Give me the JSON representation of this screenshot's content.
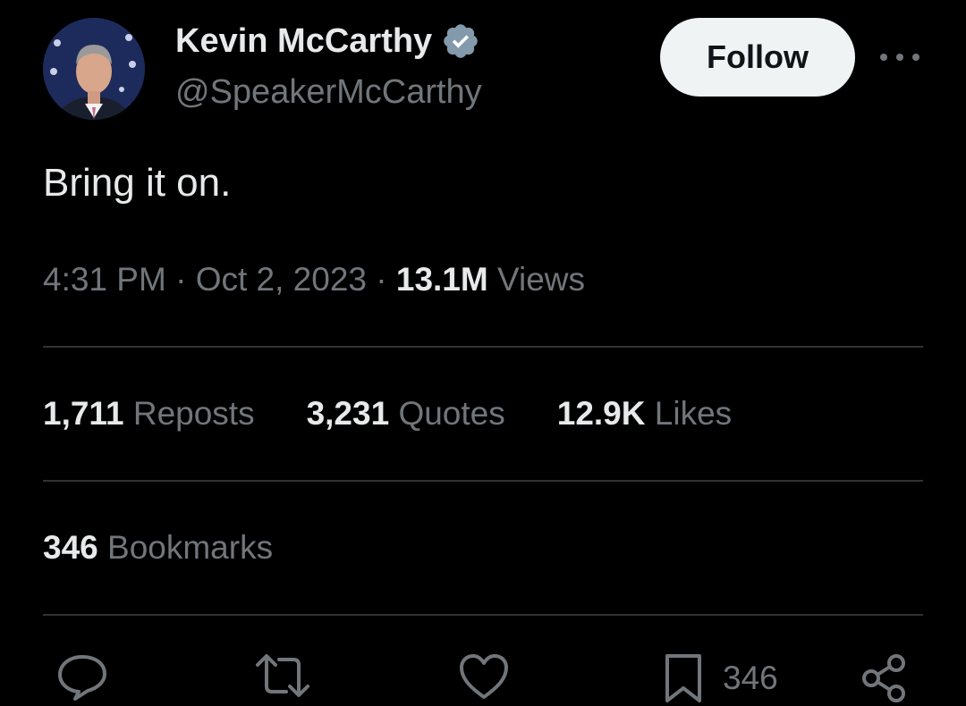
{
  "author": {
    "display_name": "Kevin McCarthy",
    "handle": "@SpeakerMcCarthy",
    "verified_icon": "verified-badge-icon",
    "avatar": "profile-photo"
  },
  "header": {
    "follow_label": "Follow",
    "more_icon": "more-horizontal-icon"
  },
  "tweet": {
    "text": "Bring it on.",
    "time": "4:31 PM",
    "sep1": "·",
    "date": "Oct 2, 2023",
    "sep2": "·",
    "views_count": "13.1M",
    "views_label": "Views"
  },
  "stats": {
    "reposts_count": "1,711",
    "reposts_label": "Reposts",
    "quotes_count": "3,231",
    "quotes_label": "Quotes",
    "likes_count": "12.9K",
    "likes_label": "Likes",
    "bookmarks_count": "346",
    "bookmarks_label": "Bookmarks"
  },
  "actions": {
    "reply_icon": "reply-icon",
    "repost_icon": "repost-icon",
    "like_icon": "heart-icon",
    "bookmark_icon": "bookmark-icon",
    "bookmark_count": "346",
    "share_icon": "share-icon"
  },
  "colors": {
    "background": "#000000",
    "primary_text": "#e7e9ea",
    "secondary_text": "#71767b",
    "divider": "#2f3336",
    "verified": "#829aab",
    "follow_bg": "#eff3f4"
  }
}
